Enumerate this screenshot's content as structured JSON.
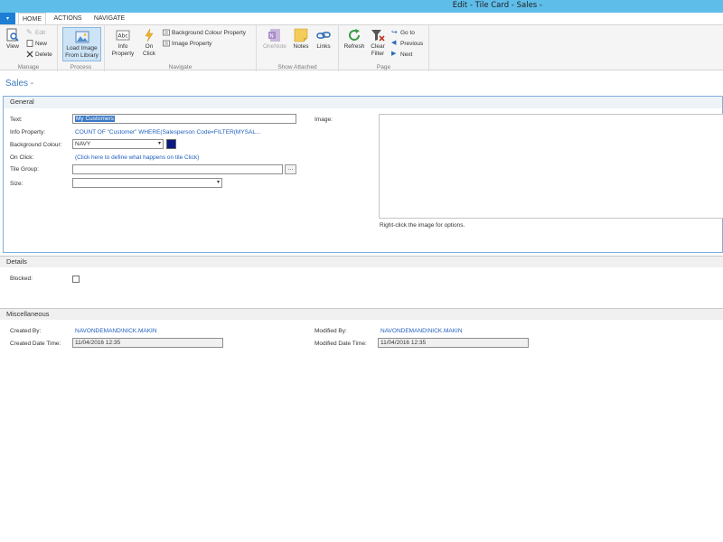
{
  "window": {
    "title": "Edit - Tile Card - Sales -"
  },
  "ribbon_tabs": [
    "HOME",
    "ACTIONS",
    "NAVIGATE"
  ],
  "ribbon": {
    "manage": {
      "label": "Manage",
      "view": "View",
      "edit": "Edit",
      "new": "New",
      "delete": "Delete"
    },
    "process": {
      "label": "Process",
      "load_image_line1": "Load Image",
      "load_image_line2": "From Library"
    },
    "navigate": {
      "label": "Navigate",
      "info_property_line1": "Info",
      "info_property_line2": "Property",
      "on_click_line1": "On",
      "on_click_line2": "Click",
      "background_colour_property": "Background Colour Property",
      "image_property": "Image Property"
    },
    "show_attached": {
      "label": "Show Attached",
      "onenote": "OneNote",
      "notes": "Notes",
      "links": "Links"
    },
    "page": {
      "label": "Page",
      "refresh": "Refresh",
      "clear_filter_line1": "Clear",
      "clear_filter_line2": "Filter",
      "go_to": "Go to",
      "previous": "Previous",
      "next": "Next"
    }
  },
  "page_title": "Sales -",
  "general": {
    "header": "General",
    "text_label": "Text:",
    "text_value": "My Customers",
    "info_property_label": "Info Property:",
    "info_property_value": "COUNT OF \"Customer\" WHERE(Salesperson Code=FILTER(MYSAL...",
    "background_colour_label": "Background Colour:",
    "background_colour_value": "NAVY",
    "background_colour_swatch": "#0a1a80",
    "on_click_label": "On Click:",
    "on_click_value": "(Click here to define what happens on tile Click)",
    "tile_group_label": "Tile Group:",
    "tile_group_value": "",
    "size_label": "Size:",
    "size_value": "",
    "image_label": "Image:",
    "image_hint": "Right-click the image for options."
  },
  "details": {
    "header": "Details",
    "blocked_label": "Blocked:",
    "blocked_checked": false
  },
  "miscellaneous": {
    "header": "Miscellaneous",
    "created_by_label": "Created By:",
    "created_by_value": "NAVONDEMAND\\NICK.MAKIN",
    "created_date_label": "Created Date Time:",
    "created_date_value": "11/04/2016 12:35",
    "modified_by_label": "Modified By:",
    "modified_by_value": "NAVONDEMAND\\NICK.MAKIN",
    "modified_date_label": "Modified Date Time:",
    "modified_date_value": "11/04/2016 12:35"
  }
}
